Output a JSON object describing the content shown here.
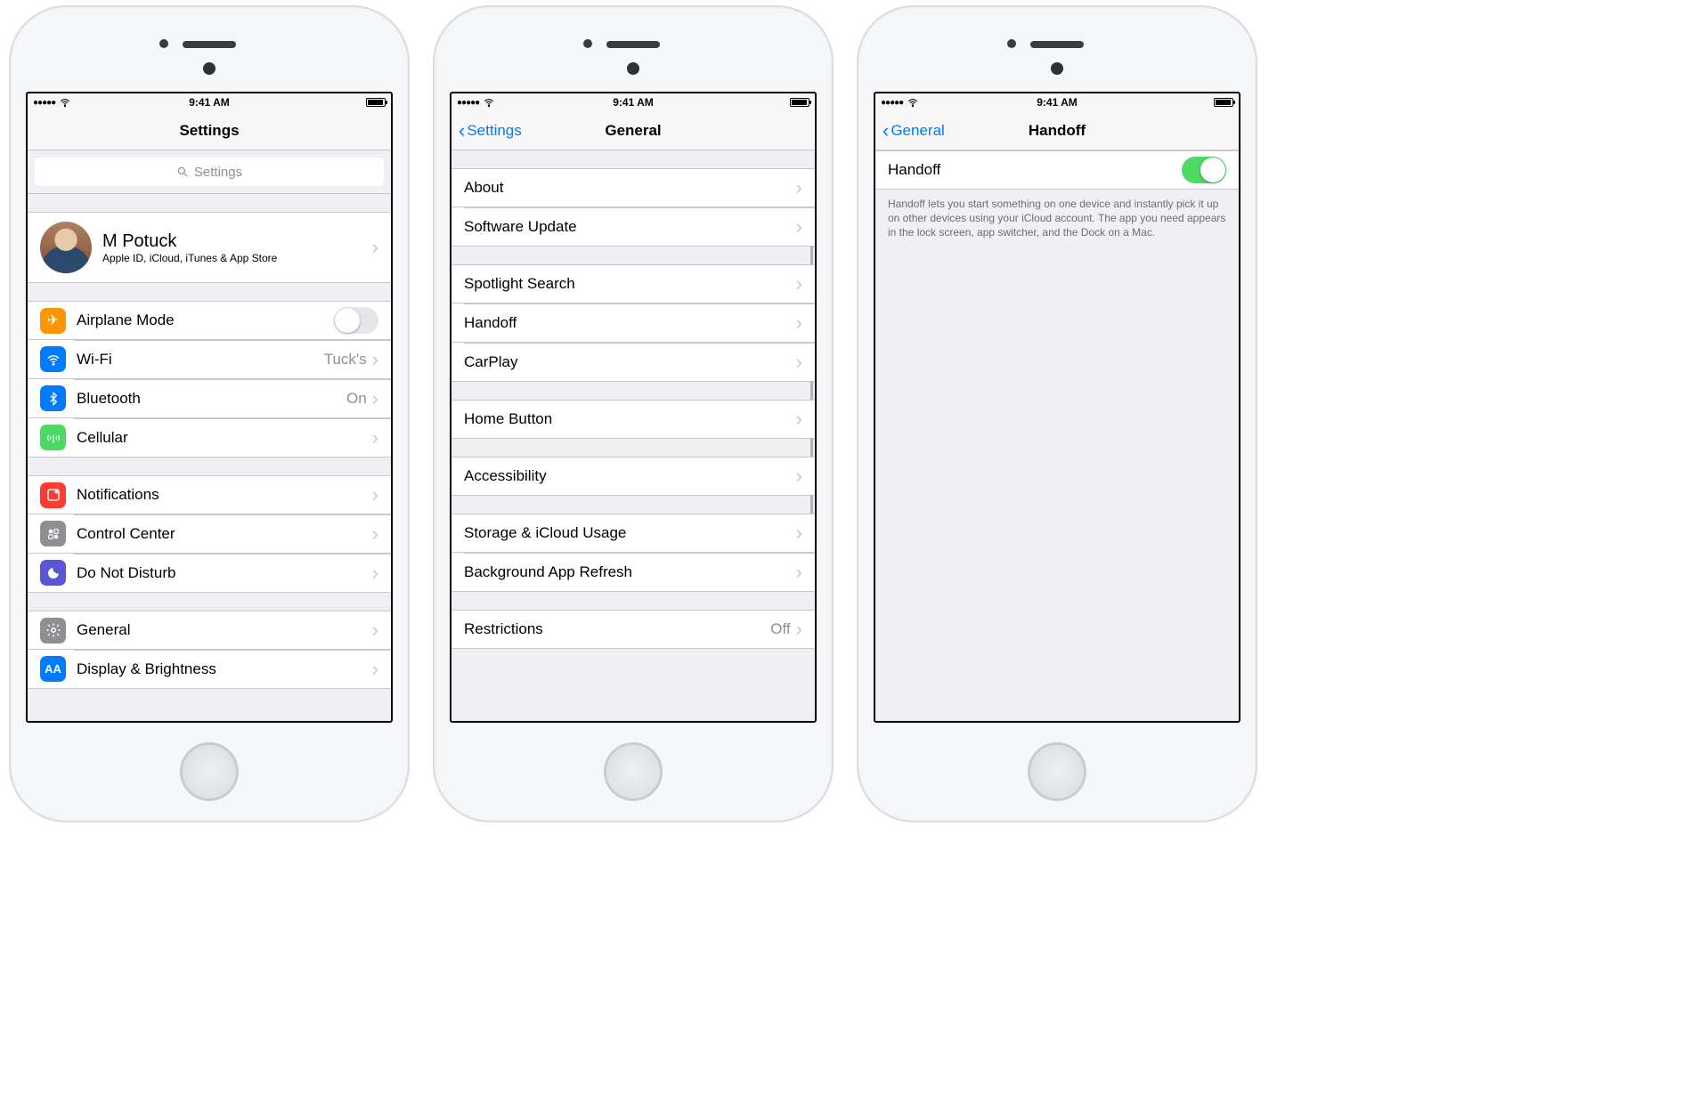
{
  "status": {
    "time": "9:41 AM"
  },
  "phone1": {
    "navTitle": "Settings",
    "searchPlaceholder": "Settings",
    "profile": {
      "name": "M Potuck",
      "sub": "Apple ID, iCloud, iTunes & App Store"
    },
    "g1": {
      "airplane": "Airplane Mode",
      "wifi": "Wi-Fi",
      "wifiVal": "Tuck's",
      "bt": "Bluetooth",
      "btVal": "On",
      "cell": "Cellular"
    },
    "g2": {
      "notif": "Notifications",
      "cc": "Control Center",
      "dnd": "Do Not Disturb"
    },
    "g3": {
      "general": "General",
      "display": "Display & Brightness"
    }
  },
  "phone2": {
    "back": "Settings",
    "navTitle": "General",
    "g1": {
      "about": "About",
      "sw": "Software Update"
    },
    "g2": {
      "spotlight": "Spotlight Search",
      "handoff": "Handoff",
      "carplay": "CarPlay"
    },
    "g3": {
      "home": "Home Button"
    },
    "g4": {
      "access": "Accessibility"
    },
    "g5": {
      "storage": "Storage & iCloud Usage",
      "bg": "Background App Refresh"
    },
    "g6": {
      "restrict": "Restrictions",
      "restrictVal": "Off"
    }
  },
  "phone3": {
    "back": "General",
    "navTitle": "Handoff",
    "row": "Handoff",
    "footer": "Handoff lets you start something on one device and instantly pick it up on other devices using your iCloud account. The app you need appears in the lock screen, app switcher, and the Dock on a Mac."
  }
}
